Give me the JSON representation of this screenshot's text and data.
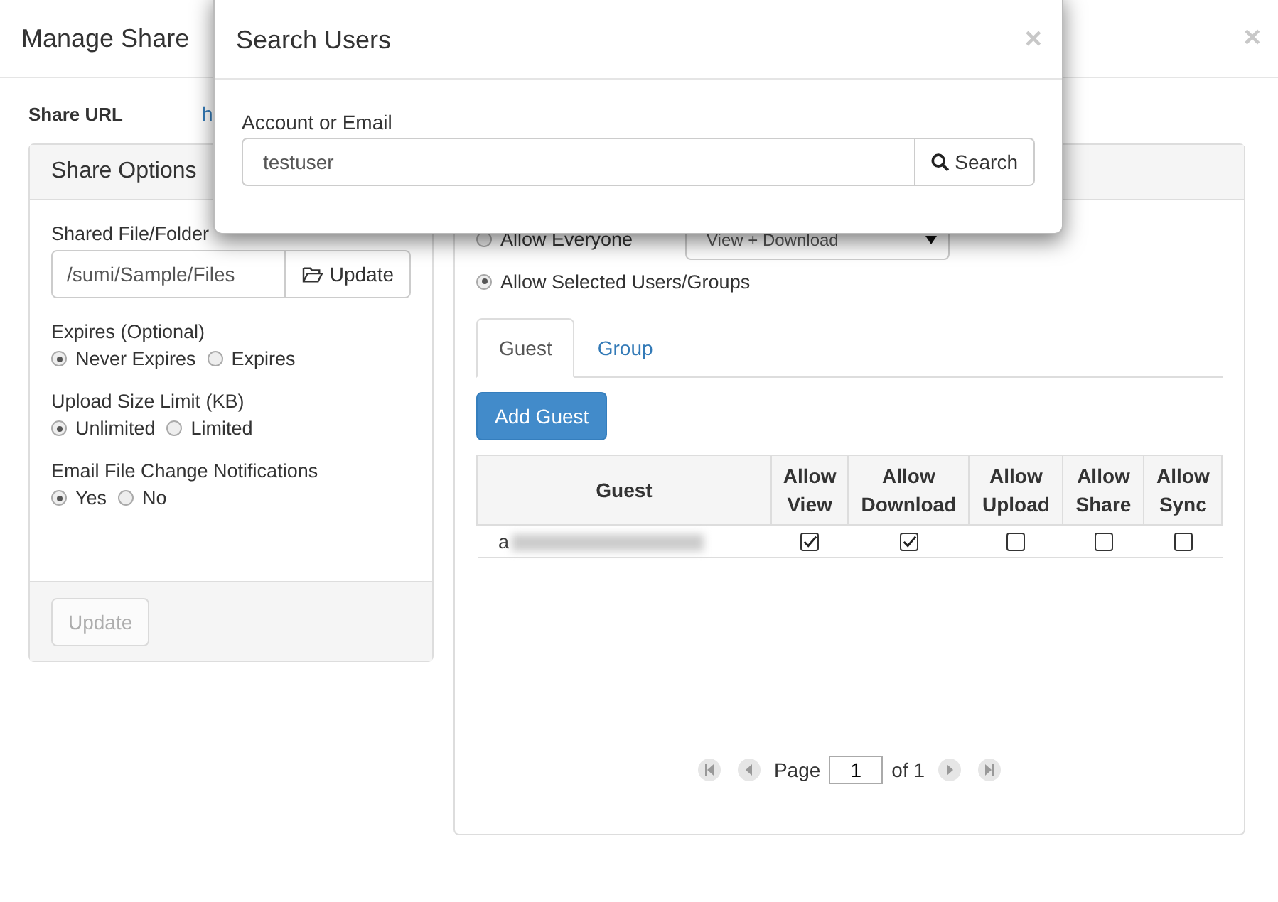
{
  "base_dialog": {
    "title": "Manage Share",
    "close": "×",
    "share_url": {
      "label": "Share URL",
      "link": "h"
    },
    "share_options": {
      "title": "Share Options",
      "shared_path": {
        "label": "Shared File/Folder",
        "value": "/sumi/Sample/Files",
        "button": "Update"
      },
      "groups": [
        {
          "label": "Expires (Optional)",
          "options": [
            {
              "label": "Never Expires",
              "selected": true
            },
            {
              "label": "Expires",
              "selected": false
            }
          ]
        },
        {
          "label": "Upload Size Limit (KB)",
          "options": [
            {
              "label": "Unlimited",
              "selected": true
            },
            {
              "label": "Limited",
              "selected": false
            }
          ]
        },
        {
          "label": "Email File Change Notifications",
          "options": [
            {
              "label": "Yes",
              "selected": true
            },
            {
              "label": "No",
              "selected": false
            }
          ]
        }
      ],
      "update_button": {
        "label": "Update",
        "disabled": true
      }
    },
    "access": {
      "options": [
        {
          "label": "Allow Everyone",
          "selected": false
        },
        {
          "label": "Allow Selected Users/Groups",
          "selected": true
        }
      ],
      "permission_select": "View + Download",
      "tabs": [
        {
          "label": "Guest",
          "selected": true
        },
        {
          "label": "Group",
          "selected": false
        }
      ],
      "add_button": "Add Guest",
      "table": {
        "columns": [
          "Guest",
          "Allow View",
          "Allow Download",
          "Allow Upload",
          "Allow Share",
          "Allow Sync"
        ],
        "rows": [
          {
            "guest": "a",
            "permissions": [
              {
                "checked": true
              },
              {
                "checked": true
              },
              {
                "checked": false
              },
              {
                "checked": false
              },
              {
                "checked": false
              }
            ]
          }
        ]
      },
      "pagination": {
        "label": "Page",
        "page": "1",
        "of": "of 1"
      }
    }
  },
  "search_dialog": {
    "title": "Search Users",
    "close": "×",
    "field": {
      "label": "Account or Email",
      "value": "testuser"
    },
    "button": "Search"
  }
}
